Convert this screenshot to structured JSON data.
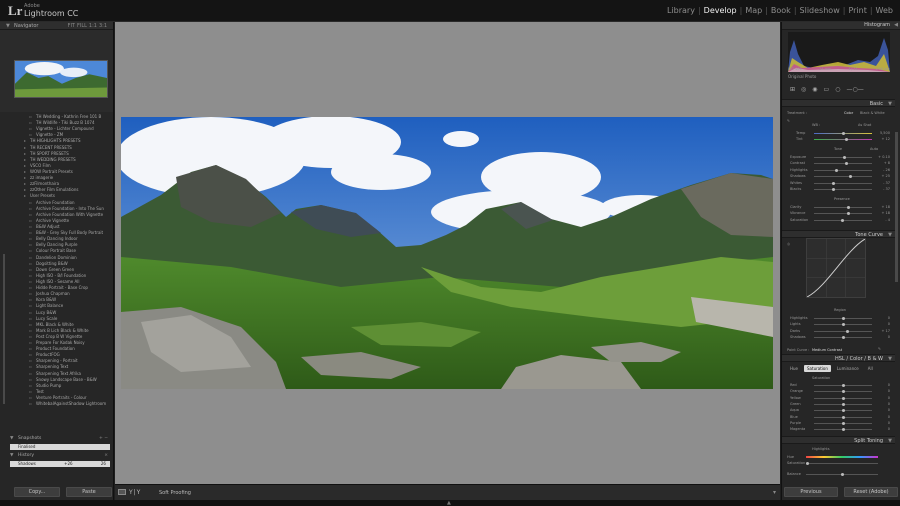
{
  "app": {
    "vendor": "Adobe",
    "name": "Lightroom CC",
    "logo": "Lr"
  },
  "modules": [
    "Library",
    "Develop",
    "Map",
    "Book",
    "Slideshow",
    "Print",
    "Web"
  ],
  "active_module": "Develop",
  "left_panel": {
    "navigator_title": "Navigator",
    "navigator_zoom": [
      "FIT",
      "FILL",
      "1:1",
      "3:1"
    ],
    "presets": [
      {
        "level": 2,
        "label": "TH Wedding - Kathrin Free 101 B"
      },
      {
        "level": 2,
        "label": "TH Wildlife - Tiki Buzz B 1074"
      },
      {
        "level": 2,
        "label": "Vignette - Lichter Compound"
      },
      {
        "level": 2,
        "label": "Vignette - ZM"
      },
      {
        "level": 1,
        "label": "TH HIGHLIGHTS PRESETS"
      },
      {
        "level": 1,
        "label": "TH RECENT PRESETS"
      },
      {
        "level": 1,
        "label": "TH SPORT PRESETS"
      },
      {
        "level": 1,
        "label": "TH WEDDING PRESETS"
      },
      {
        "level": 1,
        "label": "VSCO Film"
      },
      {
        "level": 1,
        "label": "WOW Portrait Presets"
      },
      {
        "level": 1,
        "label": "zz imagerie"
      },
      {
        "level": 1,
        "label": "zzFilmonthaira"
      },
      {
        "level": 1,
        "label": "zzOther Film Emulations"
      },
      {
        "level": 1,
        "label": "User Presets"
      },
      {
        "level": 2,
        "label": "Archive Foundation"
      },
      {
        "level": 2,
        "label": "Archive Foundation - Into The Sun"
      },
      {
        "level": 2,
        "label": "Archive Foundation With Vignette"
      },
      {
        "level": 2,
        "label": "Archive Vignette"
      },
      {
        "level": 2,
        "label": "B&W Adjust"
      },
      {
        "level": 2,
        "label": "B&W - Grey Sky Full Body Portrait"
      },
      {
        "level": 2,
        "label": "Belly Dancing Indoor"
      },
      {
        "level": 2,
        "label": "Belly Dancing Purple"
      },
      {
        "level": 2,
        "label": "Colour Portrait Base"
      },
      {
        "level": 2,
        "label": "Dandelion Dominion"
      },
      {
        "level": 2,
        "label": "Dogsitting B&W"
      },
      {
        "level": 2,
        "label": "Down Green Green"
      },
      {
        "level": 2,
        "label": "High ISO - B/I Foundation"
      },
      {
        "level": 2,
        "label": "High ISO - Sesame All"
      },
      {
        "level": 2,
        "label": "Hidde Portrait - Base Crop"
      },
      {
        "level": 2,
        "label": "Joshua Chapman"
      },
      {
        "level": 2,
        "label": "Kora B&W"
      },
      {
        "level": 2,
        "label": "Light Balance"
      },
      {
        "level": 2,
        "label": "Lucy B&W"
      },
      {
        "level": 2,
        "label": "Lucy Scale"
      },
      {
        "level": 2,
        "label": "MKL Black & White"
      },
      {
        "level": 2,
        "label": "Mark B Lich Black & White"
      },
      {
        "level": 2,
        "label": "Post Crop B W Vignette"
      },
      {
        "level": 2,
        "label": "Prepare For Kodak Noisy"
      },
      {
        "level": 2,
        "label": "Product Foundation"
      },
      {
        "level": 2,
        "label": "ProductFOG"
      },
      {
        "level": 2,
        "label": "Sharpening - Portrait"
      },
      {
        "level": 2,
        "label": "Sharpening Text"
      },
      {
        "level": 2,
        "label": "Sharpening Text Afrika"
      },
      {
        "level": 2,
        "label": "Snowy Landscape Base - B&W"
      },
      {
        "level": 2,
        "label": "Studio Pump"
      },
      {
        "level": 2,
        "label": "Test"
      },
      {
        "level": 2,
        "label": "Venture Portraits - Colour"
      },
      {
        "level": 2,
        "label": "WhitebalAgainstShadow Lightroom"
      }
    ],
    "snapshots_title": "Snapshots",
    "snapshot_item": "Finalised",
    "history_title": "History",
    "history_item": {
      "label": "Shadows",
      "value": "+26",
      "result": "26"
    },
    "copy_label": "Copy...",
    "paste_label": "Paste"
  },
  "toolbar": {
    "label": "Soft Proofing"
  },
  "right_panel": {
    "histogram_title": "Histogram",
    "histogram_info": [
      "ISO 400",
      "24 mm",
      "f / 11",
      "1/90 sec"
    ],
    "original_label": "Original Photo",
    "basic": {
      "title": "Basic",
      "treatment_label": "Treatment :",
      "treatment_color": "Color",
      "treatment_bw": "Black & White",
      "wb_label": "WB :",
      "wb_value": "As Shot",
      "temp_label": "Temp",
      "temp_value": "5,500",
      "tint_label": "Tint",
      "tint_value": "+ 12",
      "tone_label": "Tone",
      "tone_auto": "Auto",
      "sliders": [
        {
          "label": "Exposure",
          "value": "+ 0.10",
          "pos": 0.52
        },
        {
          "label": "Contrast",
          "value": "+ 8",
          "pos": 0.55
        },
        {
          "label": "Highlights",
          "value": "- 26",
          "pos": 0.38
        },
        {
          "label": "Shadows",
          "value": "+ 25",
          "pos": 0.63
        },
        {
          "label": "Whites",
          "value": "- 37",
          "pos": 0.32
        },
        {
          "label": "Blacks",
          "value": "- 37",
          "pos": 0.32
        }
      ],
      "presence_label": "Presence",
      "presence_sliders": [
        {
          "label": "Clarity",
          "value": "+ 18",
          "pos": 0.59
        },
        {
          "label": "Vibrance",
          "value": "+ 18",
          "pos": 0.59
        },
        {
          "label": "Saturation",
          "value": "- 4",
          "pos": 0.48
        }
      ]
    },
    "tone_curve": {
      "title": "Tone Curve",
      "region_label": "Region",
      "sliders": [
        {
          "label": "Highlights",
          "value": "0",
          "pos": 0.5
        },
        {
          "label": "Lights",
          "value": "0",
          "pos": 0.5
        },
        {
          "label": "Darks",
          "value": "+ 17",
          "pos": 0.58
        },
        {
          "label": "Shadows",
          "value": "0",
          "pos": 0.5
        }
      ],
      "point_curve_label": "Point Curve :",
      "point_curve_value": "Medium Contrast"
    },
    "hsl": {
      "title_parts": [
        "HSL",
        "Color",
        "B & W"
      ],
      "tabs": [
        "Hue",
        "Saturation",
        "Luminance",
        "All"
      ],
      "active_tab": "Saturation",
      "group_label": "Saturation",
      "sliders": [
        {
          "label": "Red",
          "value": "0"
        },
        {
          "label": "Orange",
          "value": "0"
        },
        {
          "label": "Yellow",
          "value": "0"
        },
        {
          "label": "Green",
          "value": "0"
        },
        {
          "label": "Aqua",
          "value": "0"
        },
        {
          "label": "Blue",
          "value": "0"
        },
        {
          "label": "Purple",
          "value": "0"
        },
        {
          "label": "Magenta",
          "value": "0"
        }
      ]
    },
    "split_toning": {
      "title": "Split Toning",
      "highlights_label": "Highlights",
      "hue_label": "Hue",
      "sat_label": "Saturation",
      "balance_label": "Balance"
    },
    "previous_label": "Previous",
    "reset_label": "Reset (Adobe)"
  },
  "colors": {
    "background": "#8e8e8e",
    "panel": "#262626",
    "active_module": "#f0f0f0",
    "selected_row": "#d9d9d9"
  }
}
